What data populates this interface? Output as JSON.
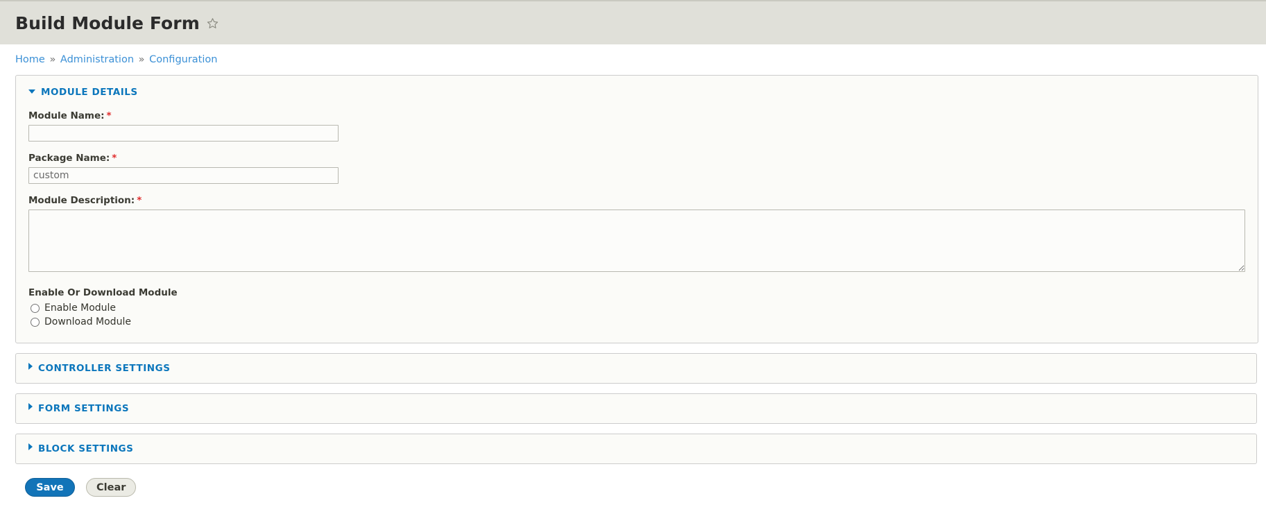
{
  "header": {
    "title": "Build Module Form",
    "favorite_icon": "star-outline-icon"
  },
  "breadcrumb": {
    "separator": "»",
    "items": [
      {
        "label": "Home"
      },
      {
        "label": "Administration"
      },
      {
        "label": "Configuration"
      }
    ]
  },
  "form": {
    "panels": [
      {
        "legend": "MODULE DETAILS",
        "state": "expanded",
        "marker": "triangle-down-icon"
      },
      {
        "legend": "CONTROLLER SETTINGS",
        "state": "collapsed",
        "marker": "triangle-right-icon"
      },
      {
        "legend": "FORM SETTINGS",
        "state": "collapsed",
        "marker": "triangle-right-icon"
      },
      {
        "legend": "BLOCK SETTINGS",
        "state": "collapsed",
        "marker": "triangle-right-icon"
      }
    ],
    "module_details": {
      "module_name": {
        "label": "Module Name:",
        "required_mark": "*",
        "value": "",
        "placeholder": ""
      },
      "package_name": {
        "label": "Package Name:",
        "required_mark": "*",
        "value": "custom",
        "placeholder": "custom"
      },
      "module_description": {
        "label": "Module Description:",
        "required_mark": "*",
        "value": "",
        "placeholder": ""
      },
      "enable_or_download": {
        "label": "Enable Or Download Module",
        "options": [
          {
            "label": "Enable Module",
            "checked": false
          },
          {
            "label": "Download Module",
            "checked": false
          }
        ]
      }
    },
    "actions": {
      "save_label": "Save",
      "clear_label": "Clear"
    }
  },
  "colors": {
    "header_band": "#e0e0d9",
    "legend_blue": "#0b76bc",
    "link_blue": "#3b90d6",
    "required_red": "#e02d2d",
    "primary_button": "#1274b8",
    "panel_background": "#fbfbf8",
    "panel_border": "#cccccc"
  }
}
